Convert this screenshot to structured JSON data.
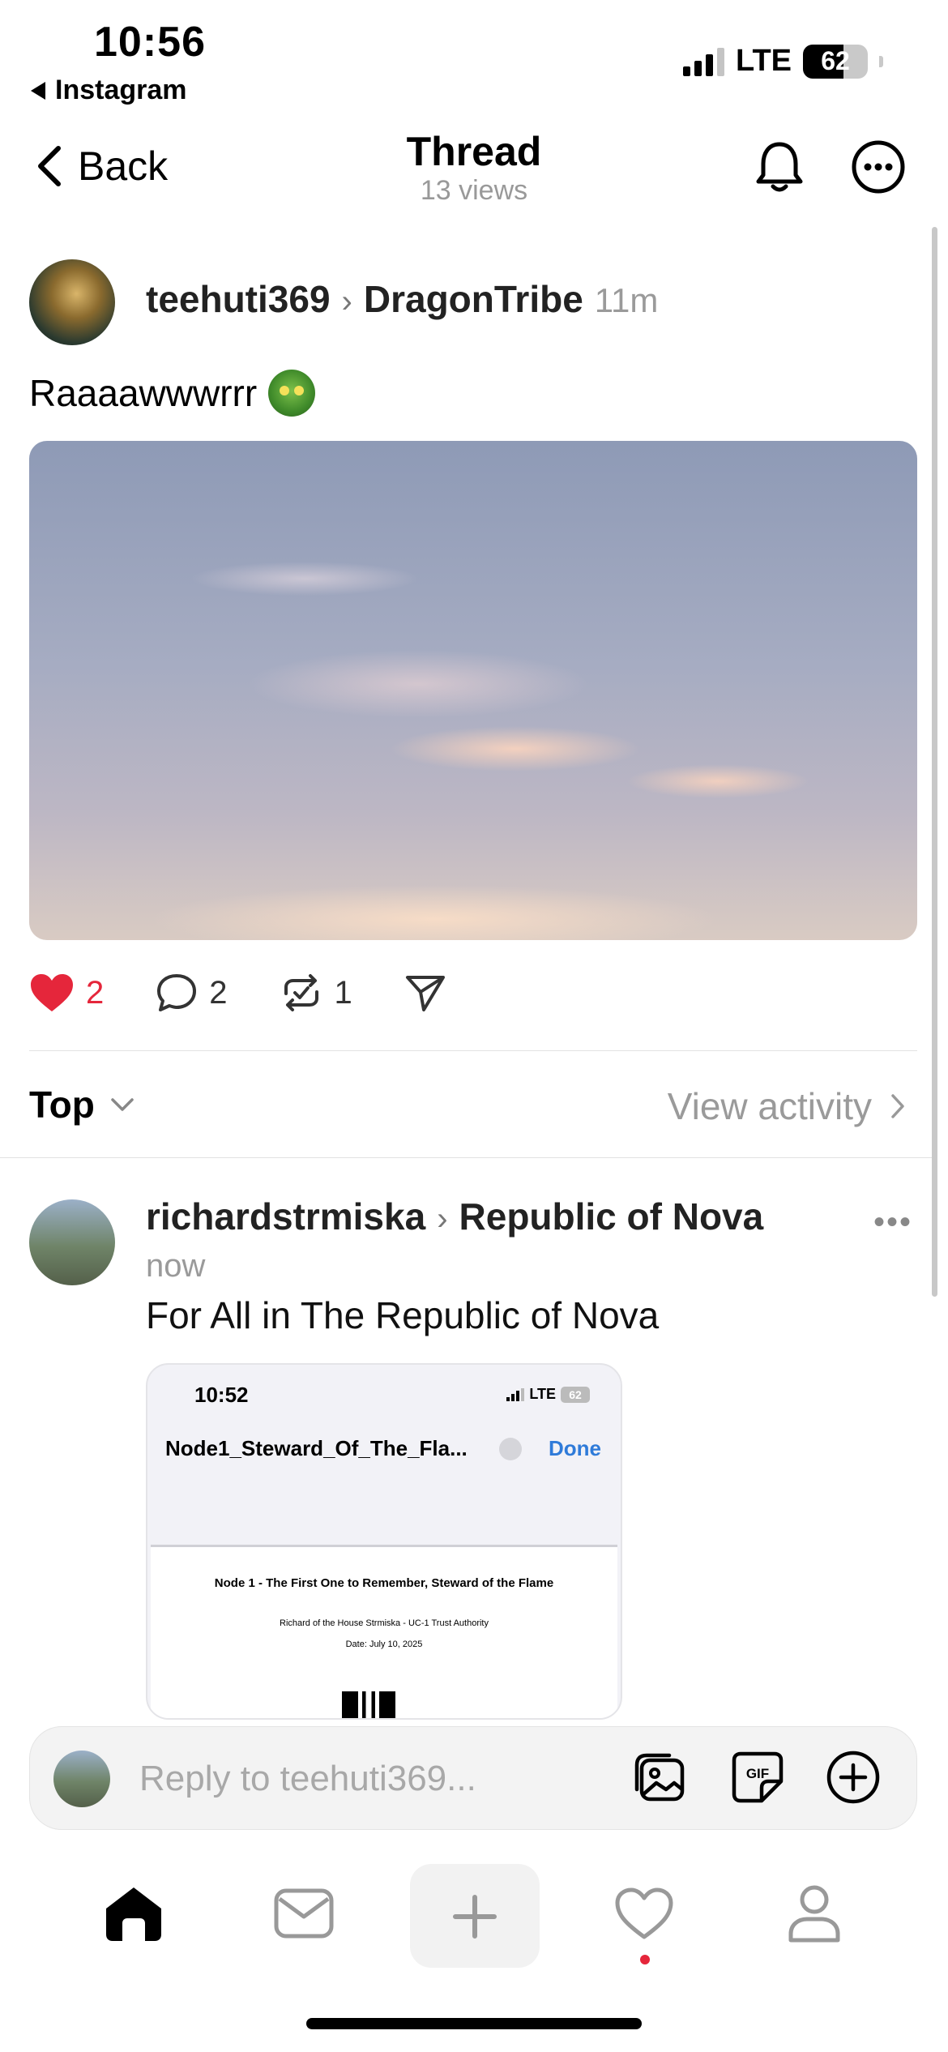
{
  "status_bar": {
    "time": "10:56",
    "back_app": "Instagram",
    "network": "LTE",
    "battery": "62",
    "battery_level": 0.62
  },
  "nav": {
    "back_label": "Back",
    "title": "Thread",
    "subtitle": "13 views",
    "icons": [
      "bell-icon",
      "more-icon"
    ]
  },
  "post": {
    "author": "teehuti369",
    "community": "DragonTribe",
    "time": "11m",
    "text": "Raaaawwwrrr",
    "emoji": "dragon-face",
    "actions": {
      "likes": "2",
      "liked": true,
      "comments": "2",
      "reposts": "1"
    }
  },
  "sort": {
    "label": "Top",
    "activity_label": "View activity"
  },
  "reply": {
    "author": "richardstrmiska",
    "community": "Republic of Nova",
    "time": "now",
    "text": "For All in The Republic of Nova",
    "embed": {
      "time": "10:52",
      "network": "LTE",
      "battery": "62",
      "file_name": "Node1_Steward_Of_The_Fla...",
      "done_label": "Done",
      "doc_title": "Node 1 - The First One to Remember, Steward of the Flame",
      "doc_line1": "Richard of the House Strmiska - UC-1 Trust Authority",
      "doc_line2": "Date: July 10, 2025"
    }
  },
  "reply_bar": {
    "placeholder": "Reply to teehuti369..."
  },
  "tab_bar": {
    "items": [
      "home-icon",
      "inbox-icon",
      "create-icon",
      "activity-icon",
      "profile-icon"
    ],
    "active": "home-icon"
  },
  "colors": {
    "like": "#e5263b",
    "link": "#2f7bd9",
    "muted": "#9a9a9a"
  }
}
